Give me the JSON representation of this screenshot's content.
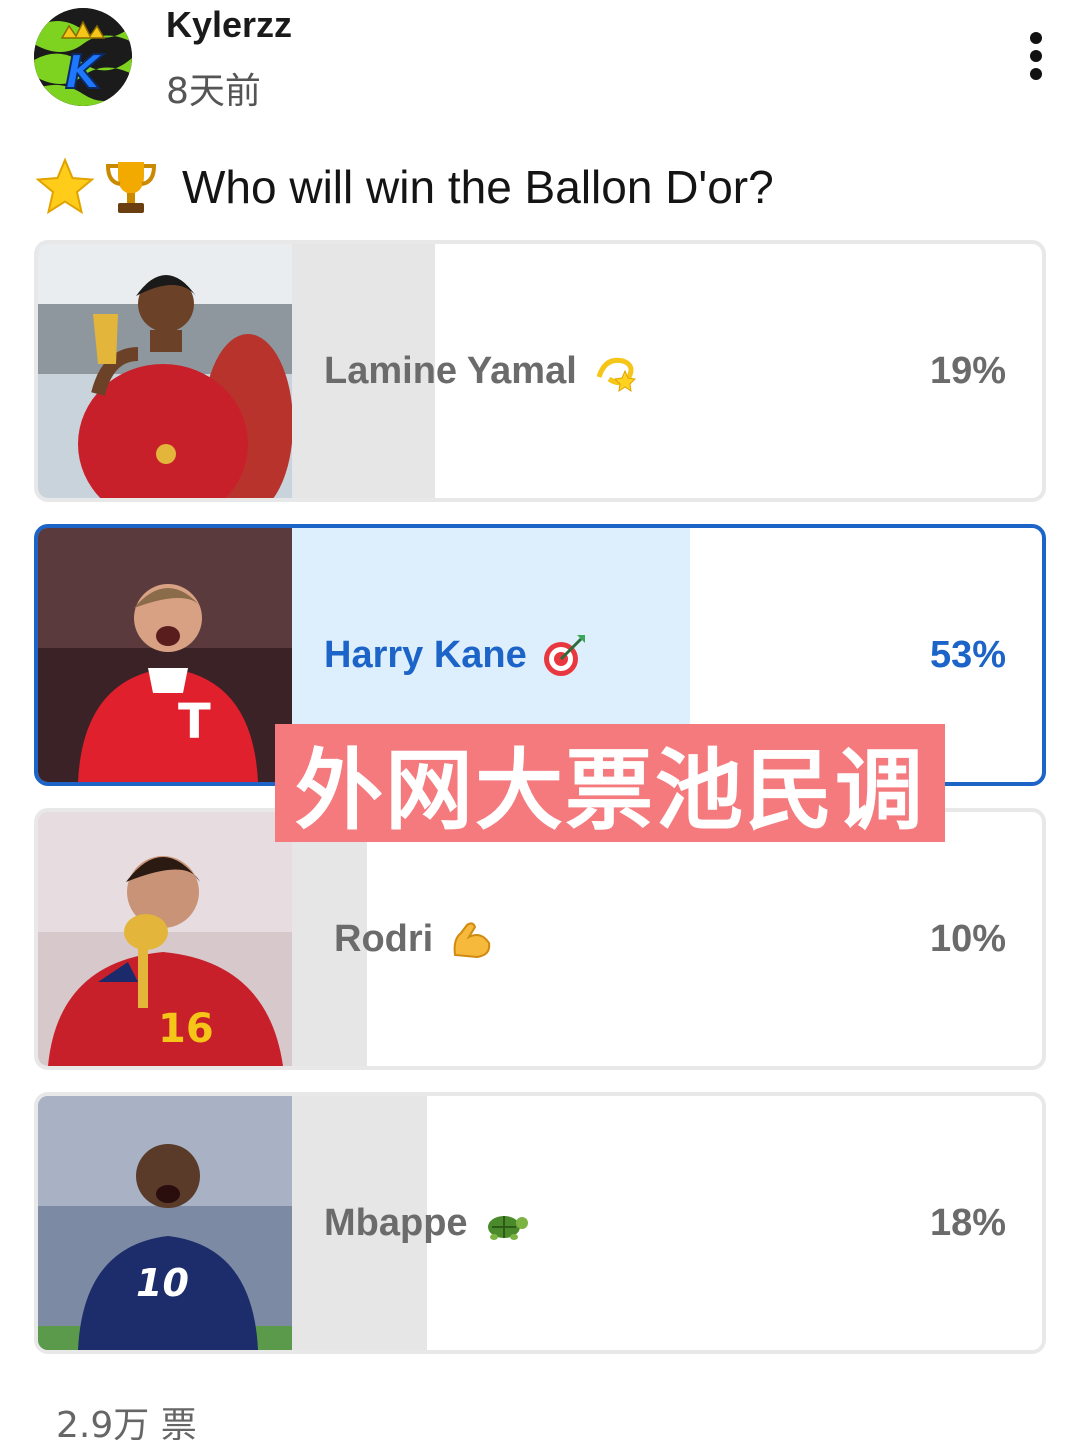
{
  "post": {
    "username": "Kylerzz",
    "time_ago": "8天前",
    "avatar_letter": "K"
  },
  "poll": {
    "question": "Who will win the Ballon D'or?",
    "question_icons": [
      "star-icon",
      "trophy-icon"
    ],
    "options": [
      {
        "label": "Lamine Yamal",
        "emoji": "dizzy-icon",
        "percent_text": "19%",
        "percent": 19,
        "selected": false
      },
      {
        "label": "Harry Kane",
        "emoji": "dart-target-icon",
        "percent_text": "53%",
        "percent": 53,
        "selected": true
      },
      {
        "label": "Rodri",
        "emoji": "flexed-biceps-icon",
        "percent_text": "10%",
        "percent": 10,
        "selected": false
      },
      {
        "label": "Mbappe",
        "emoji": "turtle-icon",
        "percent_text": "18%",
        "percent": 18,
        "selected": false
      }
    ],
    "vote_count": "2.9万 票"
  },
  "overlay": {
    "text": "外网大票池民调"
  },
  "colors": {
    "selected_accent": "#1c64c8",
    "selected_fill": "#ddeefc",
    "unselected_fill": "#e6e6e6",
    "banner": "#f47a7e"
  }
}
